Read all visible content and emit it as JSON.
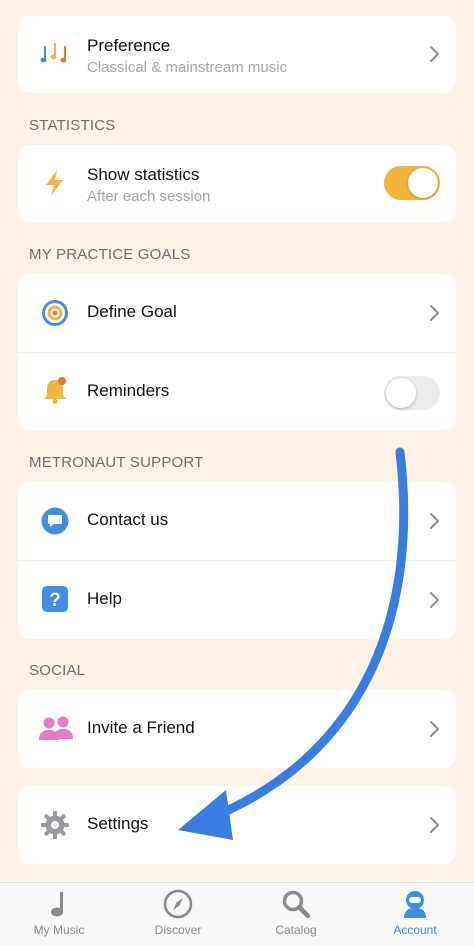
{
  "preference": {
    "title": "Preference",
    "subtitle": "Classical & mainstream music",
    "icon": "music-notes-icon"
  },
  "sections": {
    "statistics": "STATISTICS",
    "goals": "MY PRACTICE GOALS",
    "support": "METRONAUT SUPPORT",
    "social": "SOCIAL"
  },
  "statistics": {
    "title": "Show statistics",
    "subtitle": "After each session",
    "toggle_on": true,
    "icon": "lightning-icon"
  },
  "goals": {
    "define_goal": {
      "title": "Define Goal",
      "icon": "target-icon"
    },
    "reminders": {
      "title": "Reminders",
      "toggle_on": false,
      "icon": "bell-icon"
    }
  },
  "support": {
    "contact": {
      "title": "Contact us",
      "icon": "chat-bubble-icon"
    },
    "help": {
      "title": "Help",
      "icon": "question-icon"
    }
  },
  "social": {
    "invite": {
      "title": "Invite a Friend",
      "icon": "people-icon"
    }
  },
  "settings": {
    "title": "Settings",
    "icon": "gear-icon"
  },
  "tabs": [
    {
      "label": "My Music",
      "icon": "music-note-icon",
      "active": false
    },
    {
      "label": "Discover",
      "icon": "compass-icon",
      "active": false
    },
    {
      "label": "Catalog",
      "icon": "magnifier-icon",
      "active": false
    },
    {
      "label": "Account",
      "icon": "astronaut-icon",
      "active": true
    }
  ],
  "colors": {
    "background": "#fdf3e6",
    "accent_toggle": "#f3b63c",
    "active_tab": "#3c8fe0",
    "annotation_arrow": "#3a7de0"
  }
}
